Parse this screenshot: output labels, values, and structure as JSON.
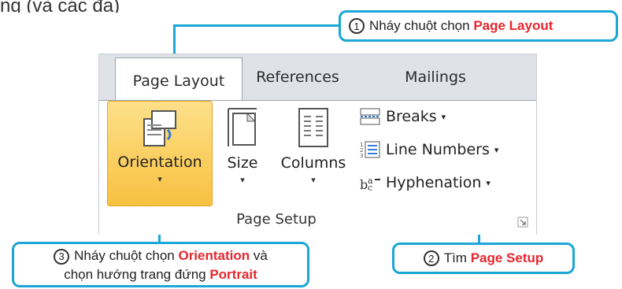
{
  "top_partial_text": "ng (và các đa)",
  "tabs": [
    {
      "label": "Page Layout",
      "active": true
    },
    {
      "label": "References",
      "active": false
    },
    {
      "label": "Mailings",
      "active": false
    }
  ],
  "page_setup": {
    "orientation": {
      "label": "Orientation",
      "caret": "▾"
    },
    "size": {
      "label": "Size",
      "caret": "▾"
    },
    "columns": {
      "label": "Columns",
      "caret": "▾"
    },
    "breaks": {
      "label": "Breaks",
      "caret": "▾"
    },
    "line_numbers": {
      "label": "Line Numbers",
      "caret": "▾"
    },
    "hyphenation": {
      "label": "Hyphenation",
      "caret": "▾"
    },
    "group_label": "Page Setup"
  },
  "callouts": {
    "c1": {
      "num": "1",
      "text": "Nháy chuột chọn ",
      "highlight": "Page Layout"
    },
    "c2": {
      "num": "2",
      "text": "Tìm ",
      "highlight": "Page Setup"
    },
    "c3": {
      "num": "3",
      "text_a": "Nháy chuột chọn ",
      "highlight_a": "Orientation",
      "text_b": " và",
      "text_c": "chọn hướng trang đứng ",
      "highlight_c": "Portrait"
    }
  },
  "colors": {
    "callout_border": "#1aa6d6",
    "highlight_red": "#e6262d",
    "orientation_bg": "#f8c140"
  }
}
